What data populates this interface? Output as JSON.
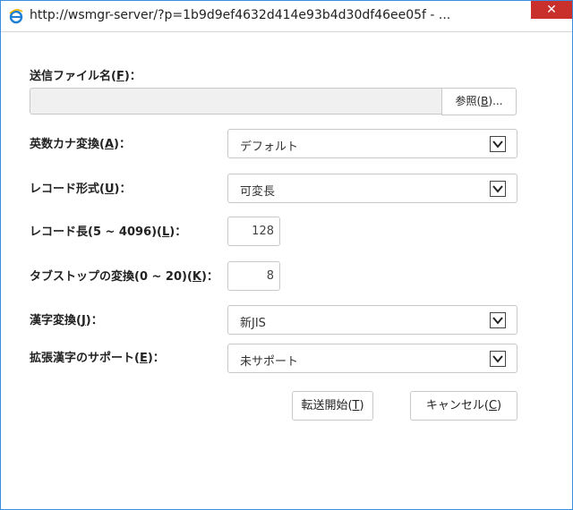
{
  "window": {
    "title": "http://wsmgr-server/?p=1b9d9ef4632d414e93b4d30df46ee05f - ...",
    "close_glyph": "✕",
    "icon": "ie-icon"
  },
  "form": {
    "send_file_label_pre": "送信ファイル名(",
    "send_file_label_key": "F",
    "send_file_label_post": ")：",
    "send_file_value": "",
    "browse_pre": "参照(",
    "browse_key": "B",
    "browse_post": ")...",
    "alnum_kana_label_pre": "英数カナ変換(",
    "alnum_kana_label_key": "A",
    "alnum_kana_label_post": ")：",
    "alnum_kana_value": "デフォルト",
    "record_format_label_pre": "レコード形式(",
    "record_format_label_key": "U",
    "record_format_label_post": ")：",
    "record_format_value": "可変長",
    "record_length_label_pre": "レコード長(5 ~ 4096)(",
    "record_length_label_key": "L",
    "record_length_label_post": ")：",
    "record_length_value": "128",
    "tab_stop_label_pre": "タブストップの変換(0 ~ 20)(",
    "tab_stop_label_key": "K",
    "tab_stop_label_post": ")：",
    "tab_stop_value": "8",
    "kanji_label_pre": "漢字変換(",
    "kanji_label_key": "J",
    "kanji_label_post": ")：",
    "kanji_value": "新JIS",
    "ext_kanji_label_pre": "拡張漢字のサポート(",
    "ext_kanji_label_key": "E",
    "ext_kanji_label_post": ")：",
    "ext_kanji_value": "未サポート"
  },
  "buttons": {
    "start_pre": "転送開始(",
    "start_key": "T",
    "start_post": ")",
    "cancel_pre": "キャンセル(",
    "cancel_key": "C",
    "cancel_post": ")"
  },
  "colors": {
    "window_border": "#3c8de0",
    "close_button": "#c9302c",
    "file_input_bg": "#f0f0f0"
  }
}
